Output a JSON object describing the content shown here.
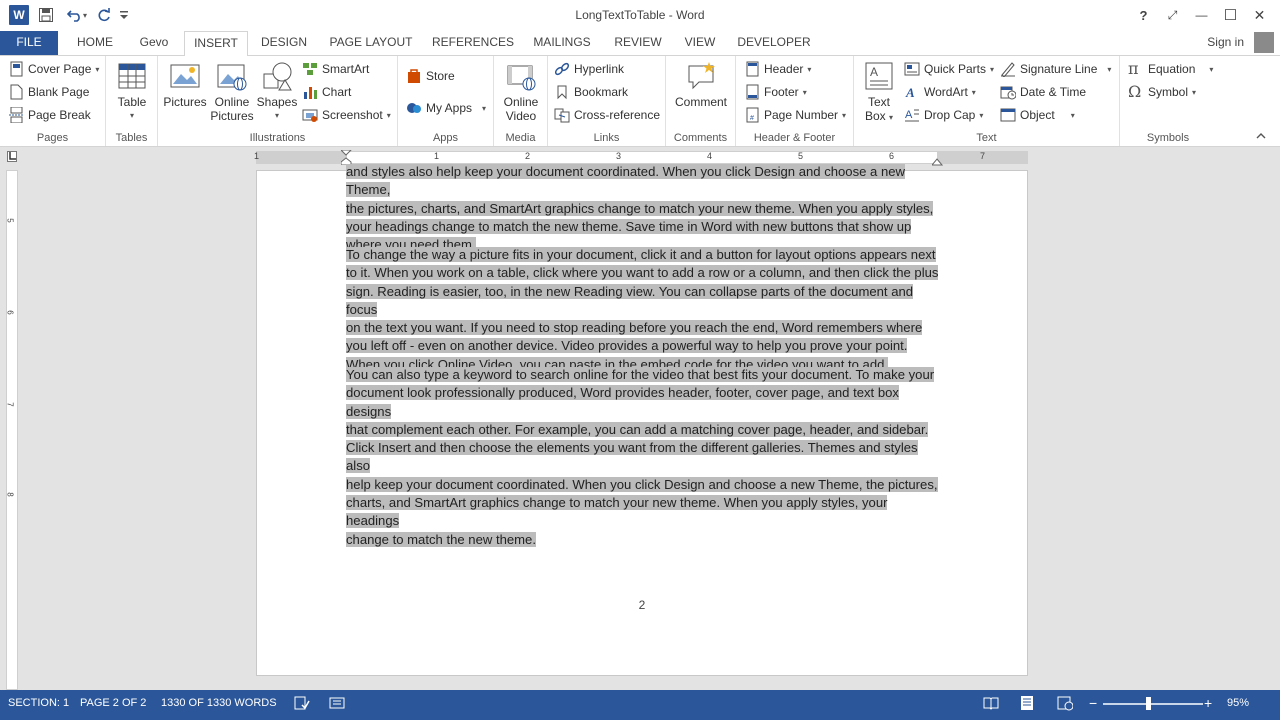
{
  "window": {
    "title": "LongTextToTable - Word"
  },
  "qat": {
    "app_icon": "word-logo-icon",
    "app_letter": "W"
  },
  "title_controls": {
    "help": "?",
    "ribbon_display": "⤢",
    "minimize": "—",
    "maximize": "☐",
    "close": "✕"
  },
  "tabs": {
    "file": "FILE",
    "home": "HOME",
    "gevo": "Gevo",
    "insert": "INSERT",
    "design": "DESIGN",
    "page_layout": "PAGE LAYOUT",
    "references": "REFERENCES",
    "mailings": "MAILINGS",
    "review": "REVIEW",
    "view": "VIEW",
    "developer": "DEVELOPER",
    "active": "INSERT"
  },
  "account": {
    "sign_in": "Sign in"
  },
  "ribbon": {
    "pages": {
      "label": "Pages",
      "cover_page": "Cover Page",
      "blank_page": "Blank Page",
      "page_break": "Page Break"
    },
    "tables": {
      "label": "Tables",
      "table": "Table"
    },
    "illustrations": {
      "label": "Illustrations",
      "pictures": "Pictures",
      "online_pictures_1": "Online",
      "online_pictures_2": "Pictures",
      "shapes": "Shapes",
      "smartart": "SmartArt",
      "chart": "Chart",
      "screenshot": "Screenshot"
    },
    "apps": {
      "label": "Apps",
      "store": "Store",
      "my_apps": "My Apps"
    },
    "media": {
      "label": "Media",
      "online_video_1": "Online",
      "online_video_2": "Video"
    },
    "links": {
      "label": "Links",
      "hyperlink": "Hyperlink",
      "bookmark": "Bookmark",
      "cross_reference": "Cross-reference"
    },
    "comments": {
      "label": "Comments",
      "comment": "Comment"
    },
    "header_footer": {
      "label": "Header & Footer",
      "header": "Header",
      "footer": "Footer",
      "page_number": "Page Number"
    },
    "text": {
      "label": "Text",
      "text_box_1": "Text",
      "text_box_2": "Box",
      "quick_parts": "Quick Parts",
      "wordart": "WordArt",
      "drop_cap": "Drop Cap",
      "signature_line": "Signature Line",
      "date_time": "Date & Time",
      "object": "Object"
    },
    "symbols": {
      "label": "Symbols",
      "equation": "Equation",
      "symbol": "Symbol"
    }
  },
  "ruler": {
    "h_numbers": [
      "1",
      "1",
      "2",
      "3",
      "4",
      "5",
      "6",
      "7"
    ],
    "v_numbers": [
      "5",
      "6",
      "7",
      "8"
    ]
  },
  "document": {
    "para0_lines": [
      "and styles also help keep your document coordinated. When you click Design and choose a new Theme,",
      "the pictures, charts, and SmartArt graphics change to match your new theme. When you apply styles,",
      "your headings change to match the new theme. Save time in Word with new buttons that show up",
      "where you need them."
    ],
    "para1_lines": [
      "To change the way a picture fits in your document, click it and a button for layout options appears next",
      "to it. When you work on a table, click where you want to add a row or a column, and then click the plus",
      "sign. Reading is easier, too, in the new Reading view. You can collapse parts of the document and focus",
      "on the text you want. If you need to stop reading before you reach the end, Word remembers where",
      "you left off - even on another device. Video provides a powerful way to help you prove your point.",
      "When you click Online Video, you can paste in the embed code for the video you want to add."
    ],
    "para2_lines": [
      "You can also type a keyword to search online for the video that best fits your document. To make your",
      "document look professionally produced, Word provides header, footer, cover page, and text box designs",
      "that complement each other. For example, you can add a matching cover page, header, and sidebar.",
      "Click Insert and then choose the elements you want from the different galleries. Themes and styles also",
      "help keep your document coordinated. When you click Design and choose a new Theme, the pictures,",
      "charts, and SmartArt graphics change to match your new theme. When you apply styles, your headings",
      "change to match the new theme."
    ],
    "page_number": "2"
  },
  "status": {
    "section": "SECTION: 1",
    "page": "PAGE 2 OF 2",
    "words": "1330 OF 1330 WORDS",
    "zoom_minus": "−",
    "zoom_plus": "+",
    "zoom": "95%",
    "zoom_level": 0.95
  },
  "colors": {
    "accent": "#2b579a",
    "selection": "#bcbcbc"
  }
}
